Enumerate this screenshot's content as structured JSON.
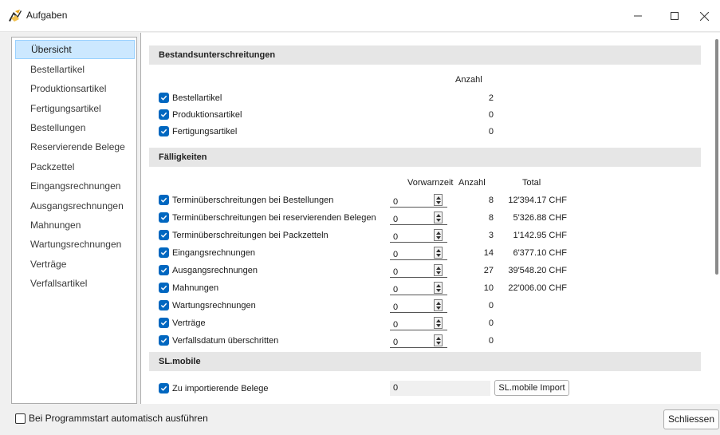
{
  "window": {
    "title": "Aufgaben",
    "icon": "tasks-app-icon",
    "controls": {
      "minimize": "─",
      "maximize": "☐",
      "close": "✕"
    }
  },
  "sidebar": {
    "items": [
      {
        "label": "Übersicht",
        "selected": true
      },
      {
        "label": "Bestellartikel",
        "selected": false
      },
      {
        "label": "Produktionsartikel",
        "selected": false
      },
      {
        "label": "Fertigungsartikel",
        "selected": false
      },
      {
        "label": "Bestellungen",
        "selected": false
      },
      {
        "label": "Reservierende Belege",
        "selected": false
      },
      {
        "label": "Packzettel",
        "selected": false
      },
      {
        "label": "Eingangsrechnungen",
        "selected": false
      },
      {
        "label": "Ausgangsrechnungen",
        "selected": false
      },
      {
        "label": "Mahnungen",
        "selected": false
      },
      {
        "label": "Wartungsrechnungen",
        "selected": false
      },
      {
        "label": "Verträge",
        "selected": false
      },
      {
        "label": "Verfallsartikel",
        "selected": false
      }
    ]
  },
  "bestand": {
    "title": "Bestandsunterschreitungen",
    "col_anzahl": "Anzahl",
    "rows": [
      {
        "label": "Bestellartikel",
        "checked": true,
        "anzahl": "2"
      },
      {
        "label": "Produktionsartikel",
        "checked": true,
        "anzahl": "0"
      },
      {
        "label": "Fertigungsartikel",
        "checked": true,
        "anzahl": "0"
      }
    ]
  },
  "faellig": {
    "title": "Fälligkeiten",
    "col_vorwarnzeit": "Vorwarnzeit",
    "col_anzahl": "Anzahl",
    "col_total": "Total",
    "rows": [
      {
        "label": "Terminüberschreitungen bei Bestellungen",
        "checked": true,
        "vorwarnzeit": "0",
        "anzahl": "8",
        "total": "12'394.17 CHF"
      },
      {
        "label": "Terminüberschreitungen bei reservierenden Belegen",
        "checked": true,
        "vorwarnzeit": "0",
        "anzahl": "8",
        "total": "5'326.88 CHF"
      },
      {
        "label": "Terminüberschreitungen bei Packzetteln",
        "checked": true,
        "vorwarnzeit": "0",
        "anzahl": "3",
        "total": "1'142.95 CHF"
      },
      {
        "label": "Eingangsrechnungen",
        "checked": true,
        "vorwarnzeit": "0",
        "anzahl": "14",
        "total": "6'377.10 CHF"
      },
      {
        "label": "Ausgangsrechnungen",
        "checked": true,
        "vorwarnzeit": "0",
        "anzahl": "27",
        "total": "39'548.20 CHF"
      },
      {
        "label": "Mahnungen",
        "checked": true,
        "vorwarnzeit": "0",
        "anzahl": "10",
        "total": "22'006.00 CHF"
      },
      {
        "label": "Wartungsrechnungen",
        "checked": true,
        "vorwarnzeit": "0",
        "anzahl": "0",
        "total": ""
      },
      {
        "label": "Verträge",
        "checked": true,
        "vorwarnzeit": "0",
        "anzahl": "0",
        "total": ""
      },
      {
        "label": "Verfallsdatum überschritten",
        "checked": true,
        "vorwarnzeit": "0",
        "anzahl": "0",
        "total": ""
      }
    ]
  },
  "slmobile": {
    "title": "SL.mobile",
    "row": {
      "label": "Zu importierende Belege",
      "checked": true,
      "value": "0"
    },
    "import_button": "SL.mobile Import"
  },
  "footer": {
    "autostart_label": "Bei Programmstart automatisch ausführen",
    "autostart_checked": false,
    "close_button": "Schliessen"
  },
  "colors": {
    "accent": "#0067c0",
    "selection_bg": "#cce8ff",
    "section_header_bg": "#e6e6e6"
  }
}
